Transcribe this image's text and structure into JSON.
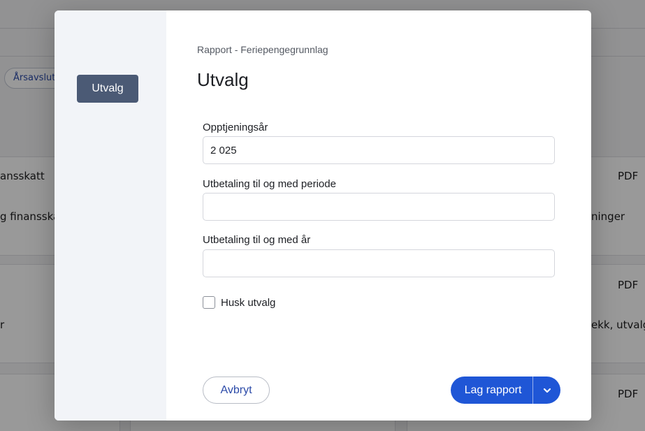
{
  "background": {
    "chip": "Årsavslutn",
    "texts": [
      "ansskatt",
      "g finansska",
      "PDF",
      "ninger",
      "PDF",
      "r",
      "ekk, utvalg",
      "PDF"
    ]
  },
  "modal": {
    "sidebar": {
      "step_label": "Utvalg"
    },
    "breadcrumb": "Rapport - Feriepengegrunnlag",
    "title": "Utvalg",
    "fields": [
      {
        "label": "Opptjeningsår",
        "value": "2 025",
        "placeholder": ""
      },
      {
        "label": "Utbetaling til og med periode",
        "value": "",
        "placeholder": ""
      },
      {
        "label": "Utbetaling til og med år",
        "value": "",
        "placeholder": ""
      }
    ],
    "remember": {
      "label": "Husk utvalg",
      "checked": false
    },
    "actions": {
      "cancel_label": "Avbryt",
      "submit_label": "Lag rapport",
      "dropdown_icon": "chevron-down-icon"
    }
  },
  "colors": {
    "primary": "#1f56d6",
    "sidebar_step": "#4b5a75",
    "link": "#2b4aa8"
  }
}
